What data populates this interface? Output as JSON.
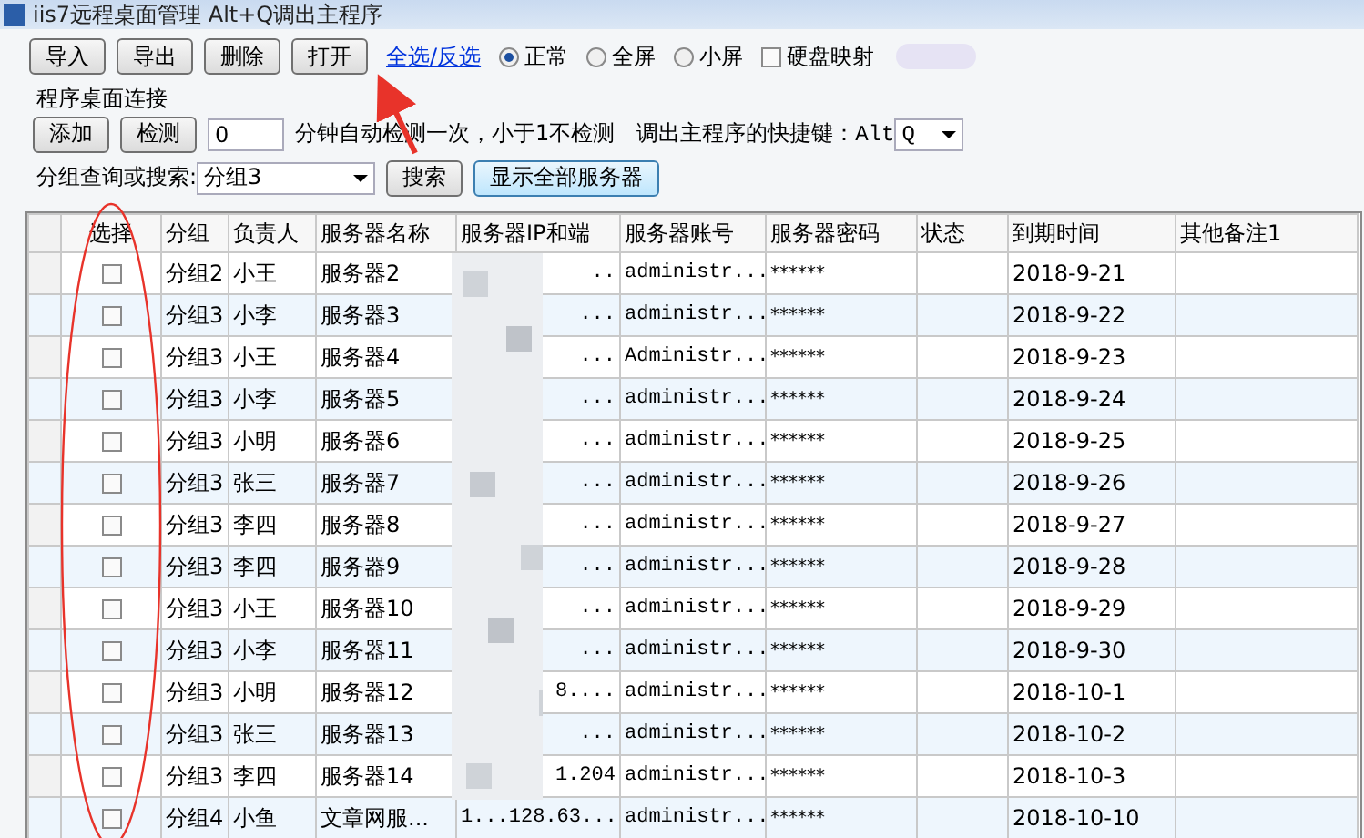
{
  "window": {
    "title": "iis7远程桌面管理 Alt+Q调出主程序"
  },
  "toolbar": {
    "buttons": [
      "导入",
      "导出",
      "删除",
      "打开"
    ],
    "link": "全选/反选",
    "radios": [
      {
        "label": "正常",
        "selected": true
      },
      {
        "label": "全屏",
        "selected": false
      },
      {
        "label": "小屏",
        "selected": false
      }
    ],
    "checkbox": {
      "label": "硬盘映射",
      "checked": false
    }
  },
  "group": {
    "title": "程序桌面连接",
    "buttons": [
      "添加",
      "检测"
    ],
    "interval": {
      "value": "0"
    },
    "interval_note": "分钟自动检测一次，小于1不检测",
    "shortcut_label": "调出主程序的快捷键：Alt",
    "shortcut_key": "Q",
    "search_label": "分组查询或搜索:",
    "search_value": "分组3",
    "search_button": "搜索",
    "show_all_button": "显示全部服务器"
  },
  "table": {
    "columns": [
      "选择",
      "分组",
      "负责人",
      "服务器名称",
      "服务器IP和端",
      "服务器账号",
      "服务器密码",
      "状态",
      "到期时间",
      "其他备注1"
    ],
    "rows": [
      {
        "checked": false,
        "group": "分组2",
        "owner": "小王",
        "name": "服务器2",
        "ip": "..",
        "account": "administr...",
        "password": "******",
        "expiry": "2018-9-21"
      },
      {
        "checked": false,
        "group": "分组3",
        "owner": "小李",
        "name": "服务器3",
        "ip": "...",
        "account": "administr...",
        "password": "******",
        "expiry": "2018-9-22"
      },
      {
        "checked": false,
        "group": "分组3",
        "owner": "小王",
        "name": "服务器4",
        "ip": "...",
        "account": "Administr...",
        "password": "******",
        "expiry": "2018-9-23"
      },
      {
        "checked": false,
        "group": "分组3",
        "owner": "小李",
        "name": "服务器5",
        "ip": "...",
        "account": "administr...",
        "password": "******",
        "expiry": "2018-9-24"
      },
      {
        "checked": false,
        "group": "分组3",
        "owner": "小明",
        "name": "服务器6",
        "ip": "...",
        "account": "administr...",
        "password": "******",
        "expiry": "2018-9-25"
      },
      {
        "checked": false,
        "group": "分组3",
        "owner": "张三",
        "name": "服务器7",
        "ip": "...",
        "account": "administr...",
        "password": "******",
        "expiry": "2018-9-26"
      },
      {
        "checked": false,
        "group": "分组3",
        "owner": "李四",
        "name": "服务器8",
        "ip": "...",
        "account": "administr...",
        "password": "******",
        "expiry": "2018-9-27"
      },
      {
        "checked": false,
        "group": "分组3",
        "owner": "李四",
        "name": "服务器9",
        "ip": "...",
        "account": "administr...",
        "password": "******",
        "expiry": "2018-9-28"
      },
      {
        "checked": false,
        "group": "分组3",
        "owner": "小王",
        "name": "服务器10",
        "ip": "...",
        "account": "administr...",
        "password": "******",
        "expiry": "2018-9-29"
      },
      {
        "checked": false,
        "group": "分组3",
        "owner": "小李",
        "name": "服务器11",
        "ip": "...",
        "account": "administr...",
        "password": "******",
        "expiry": "2018-9-30"
      },
      {
        "checked": false,
        "group": "分组3",
        "owner": "小明",
        "name": "服务器12",
        "ip": "8....",
        "account": "administr...",
        "password": "******",
        "expiry": "2018-10-1"
      },
      {
        "checked": false,
        "group": "分组3",
        "owner": "张三",
        "name": "服务器13",
        "ip": "...",
        "account": "administr...",
        "password": "******",
        "expiry": "2018-10-2"
      },
      {
        "checked": false,
        "group": "分组3",
        "owner": "李四",
        "name": "服务器14",
        "ip": "1.204",
        "account": "administr...",
        "password": "******",
        "expiry": "2018-10-3"
      },
      {
        "checked": false,
        "group": "分组4",
        "owner": "小鱼",
        "name": "文章网服...",
        "ip": "1...128.63...",
        "account": "administr...",
        "password": "******",
        "expiry": "2018-10-10"
      }
    ]
  }
}
